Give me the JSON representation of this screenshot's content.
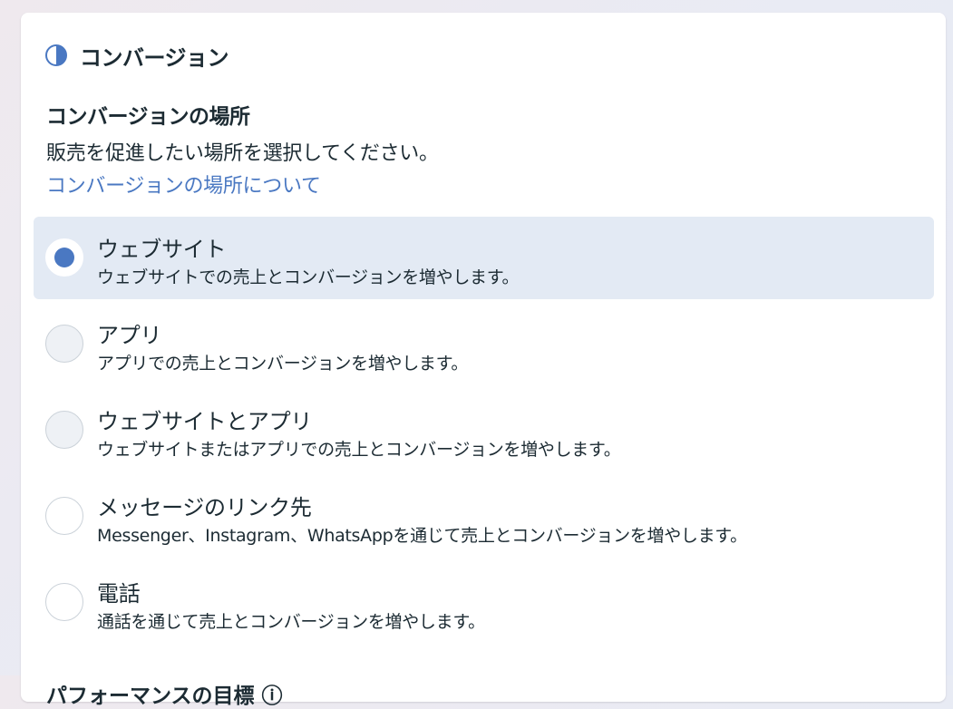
{
  "header": {
    "icon": "halfcircle-icon",
    "title": "コンバージョン"
  },
  "section": {
    "title": "コンバージョンの場所",
    "description": "販売を促進したい場所を選択してください。",
    "link": "コンバージョンの場所について"
  },
  "options": [
    {
      "title": "ウェブサイト",
      "desc": "ウェブサイトでの売上とコンバージョンを増やします。",
      "state": "selected"
    },
    {
      "title": "アプリ",
      "desc": "アプリでの売上とコンバージョンを増やします。",
      "state": "disabled"
    },
    {
      "title": "ウェブサイトとアプリ",
      "desc": "ウェブサイトまたはアプリでの売上とコンバージョンを増やします。",
      "state": "disabled"
    },
    {
      "title": "メッセージのリンク先",
      "desc": "Messenger、Instagram、WhatsAppを通じて売上とコンバージョンを増やします。",
      "state": "enabled"
    },
    {
      "title": "電話",
      "desc": "通話を通じて売上とコンバージョンを増やします。",
      "state": "enabled"
    }
  ],
  "next_section": {
    "title": "パフォーマンスの目標 ⓘ"
  },
  "colors": {
    "accent": "#4a78c2",
    "selected_bg": "#e3eaf4",
    "text": "#1c2b33"
  }
}
